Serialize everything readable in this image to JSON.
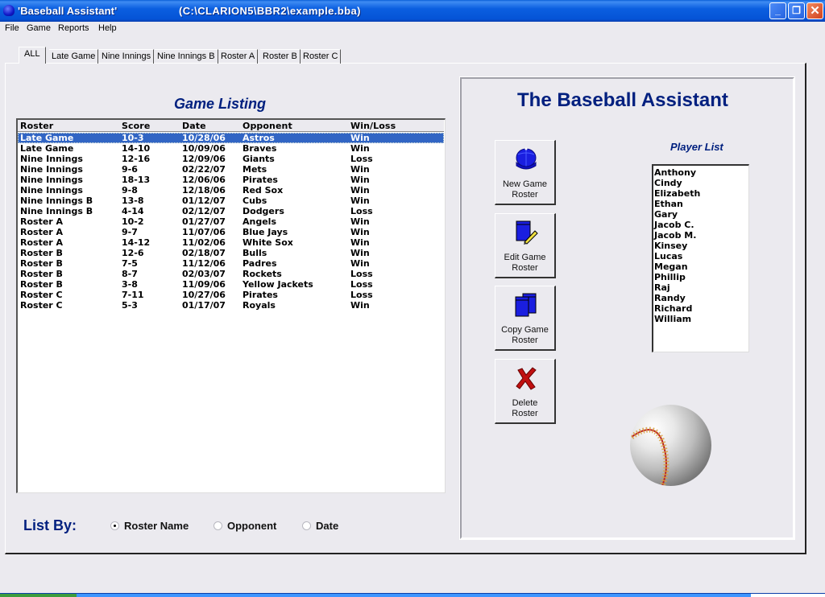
{
  "window": {
    "title": "'Baseball Assistant'",
    "path": "(C:\\CLARION5\\BBR2\\example.bba)",
    "buttons": {
      "minimize": "_",
      "maximize": "❐",
      "close": "✕"
    }
  },
  "menu": [
    "File",
    "Game",
    "Reports",
    "Help"
  ],
  "tabs": [
    {
      "label": "ALL",
      "active": true
    },
    {
      "label": "Late Game",
      "active": false
    },
    {
      "label": "Nine Innings",
      "active": false
    },
    {
      "label": "Nine Innings B",
      "active": false
    },
    {
      "label": "Roster A",
      "active": false
    },
    {
      "label": "Roster B",
      "active": false
    },
    {
      "label": "Roster C",
      "active": false
    }
  ],
  "game_listing": {
    "title": "Game Listing",
    "columns": [
      "Roster",
      "Score",
      "Date",
      "Opponent",
      "Win/Loss"
    ],
    "selected_index": 0,
    "rows": [
      [
        "Late Game",
        "10-3",
        "10/28/06",
        "Astros",
        "Win"
      ],
      [
        "Late Game",
        "14-10",
        "10/09/06",
        "Braves",
        "Win"
      ],
      [
        "Nine Innings",
        "12-16",
        "12/09/06",
        "Giants",
        "Loss"
      ],
      [
        "Nine Innings",
        "9-6",
        "02/22/07",
        "Mets",
        "Win"
      ],
      [
        "Nine Innings",
        "18-13",
        "12/06/06",
        "Pirates",
        "Win"
      ],
      [
        "Nine Innings",
        "9-8",
        "12/18/06",
        "Red Sox",
        "Win"
      ],
      [
        "Nine Innings B",
        "13-8",
        "01/12/07",
        "Cubs",
        "Win"
      ],
      [
        "Nine Innings B",
        "4-14",
        "02/12/07",
        "Dodgers",
        "Loss"
      ],
      [
        "Roster A",
        "10-2",
        "01/27/07",
        "Angels",
        "Win"
      ],
      [
        "Roster A",
        "9-7",
        "11/07/06",
        "Blue Jays",
        "Win"
      ],
      [
        "Roster A",
        "14-12",
        "11/02/06",
        "White Sox",
        "Win"
      ],
      [
        "Roster B",
        "12-6",
        "02/18/07",
        "Bulls",
        "Win"
      ],
      [
        "Roster B",
        "7-5",
        "11/12/06",
        "Padres",
        "Win"
      ],
      [
        "Roster B",
        "8-7",
        "02/03/07",
        "Rockets",
        "Loss"
      ],
      [
        "Roster B",
        "3-8",
        "11/09/06",
        "Yellow Jackets",
        "Loss"
      ],
      [
        "Roster C",
        "7-11",
        "10/27/06",
        "Pirates",
        "Loss"
      ],
      [
        "Roster C",
        "5-3",
        "01/17/07",
        "Royals",
        "Win"
      ]
    ]
  },
  "list_by": {
    "label": "List By:",
    "options": [
      {
        "label": "Roster Name",
        "selected": true
      },
      {
        "label": "Opponent",
        "selected": false
      },
      {
        "label": "Date",
        "selected": false
      }
    ]
  },
  "right_panel": {
    "heading": "The Baseball Assistant",
    "buttons": [
      {
        "label_line1": "New Game",
        "label_line2": "Roster",
        "icon": "cap-icon"
      },
      {
        "label_line1": "Edit Game",
        "label_line2": "Roster",
        "icon": "edit-pencil-icon"
      },
      {
        "label_line1": "Copy Game",
        "label_line2": "Roster",
        "icon": "copy-pages-icon"
      },
      {
        "label_line1": "Delete",
        "label_line2": "Roster",
        "icon": "delete-x-icon"
      }
    ],
    "player_list_title": "Player List",
    "players": [
      "Anthony",
      "Cindy",
      "Elizabeth",
      "Ethan",
      "Gary",
      "Jacob C.",
      "Jacob M.",
      "Kinsey",
      "Lucas",
      "Megan",
      "Phillip",
      "Raj",
      "Randy",
      "Richard",
      "William"
    ]
  },
  "colors": {
    "heading_blue": "#00207f",
    "selection_blue": "#3165c4",
    "titlebar_blue": "#0553d6",
    "delete_red": "#c01010"
  }
}
